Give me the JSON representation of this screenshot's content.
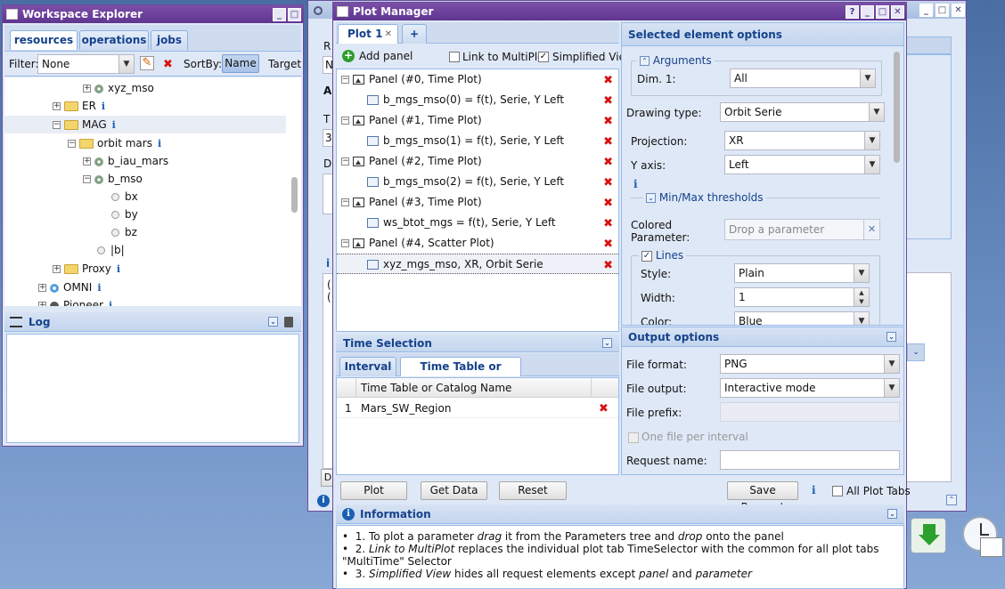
{
  "workspace_explorer": {
    "title": "Workspace Explorer",
    "tabs": [
      "resources",
      "operations",
      "jobs"
    ],
    "filter_label": "Filter:",
    "filter_value": "None",
    "sortby_label": "SortBy:",
    "sort_name": "Name",
    "sort_target": "Target",
    "tree": {
      "xyz_mso": "xyz_mso",
      "er": "ER",
      "mag": "MAG",
      "orbit_mars": "orbit mars",
      "b_iau_mars": "b_iau_mars",
      "b_mso": "b_mso",
      "bx": "bx",
      "by": "by",
      "bz": "bz",
      "b_abs": "|b|",
      "proxy": "Proxy",
      "omni": "OMNI",
      "pioneer": "Pioneer"
    },
    "info_glyph": "i"
  },
  "log": {
    "title": "Log"
  },
  "background_window": {
    "labels": [
      "R",
      "N",
      "A",
      "T",
      "3",
      "D",
      "i",
      "(",
      "(",
      "D",
      "i"
    ]
  },
  "plot_manager": {
    "title": "Plot Manager",
    "tab_label": "Plot 1",
    "add_tab": "+",
    "add_panel": "Add panel",
    "link_multiplot": "Link to MultiPlot",
    "simplified_view": "Simplified View",
    "panels": [
      {
        "panel": "Panel (#0, Time Plot)",
        "serie": "b_mgs_mso(0) = f(t), Serie, Y Left"
      },
      {
        "panel": "Panel (#1, Time Plot)",
        "serie": "b_mgs_mso(1) = f(t), Serie, Y Left"
      },
      {
        "panel": "Panel (#2, Time Plot)",
        "serie": "b_mgs_mso(2) = f(t), Serie, Y Left"
      },
      {
        "panel": "Panel (#3, Time Plot)",
        "serie": "ws_btot_mgs = f(t), Serie, Y Left"
      },
      {
        "panel": "Panel (#4, Scatter Plot)",
        "serie": "xyz_mgs_mso, XR, Orbit Serie"
      }
    ],
    "time_selection": {
      "title": "Time Selection",
      "tab_interval": "Interval",
      "tab_timetable": "Time Table or Catalog",
      "col_header": "Time Table or Catalog Name",
      "row_num": "1",
      "row_value": "Mars_SW_Region"
    },
    "selected_options": {
      "title": "Selected element options",
      "arguments_legend": "Arguments",
      "dim_label": "Dim. 1:",
      "dim_value": "All",
      "drawing_type_label": "Drawing type:",
      "drawing_type_value": "Orbit Serie",
      "projection_label": "Projection:",
      "projection_value": "XR",
      "yaxis_label": "Y axis:",
      "yaxis_value": "Left",
      "minmax_label": "Min/Max thresholds",
      "colored_param_label": "Colored Parameter:",
      "drop_placeholder": "Drop a parameter",
      "lines_legend": "Lines",
      "style_label": "Style:",
      "style_value": "Plain",
      "width_label": "Width:",
      "width_value": "1",
      "color_label": "Color:",
      "color_value": "Blue"
    },
    "output_options": {
      "title": "Output options",
      "file_format_label": "File format:",
      "file_format_value": "PNG",
      "file_output_label": "File output:",
      "file_output_value": "Interactive mode",
      "file_prefix_label": "File prefix:",
      "one_file_label": "One file per interval",
      "request_name_label": "Request name:"
    },
    "buttons": {
      "plot": "Plot",
      "get_data": "Get Data",
      "reset": "Reset",
      "save_request": "Save Request",
      "all_plot_tabs": "All Plot Tabs"
    },
    "information": {
      "title": "Information",
      "items": [
        [
          "1. To plot a parameter ",
          "drag",
          " it from the Parameters tree and ",
          "drop",
          " onto the panel"
        ],
        [
          "2. ",
          "Link to MultiPlot",
          " replaces the individual plot tab TimeSelector with the common for all plot tabs \"MultiTime\" Selector"
        ],
        [
          "3. ",
          "Simplified View",
          " hides all request elements except ",
          "panel",
          " and ",
          "parameter"
        ]
      ]
    }
  },
  "colors": {
    "title_purple": "#6b3f9c",
    "header_blue": "#15428b",
    "panel_bg": "#dfe8f6",
    "delete_red": "#d81010"
  }
}
